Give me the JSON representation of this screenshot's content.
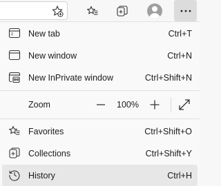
{
  "toolbar": {
    "favorite_add_icon": "star-plus-icon",
    "favorites_icon": "favorites-icon",
    "collections_icon": "collections-icon",
    "profile_icon": "avatar-icon",
    "more_icon": "ellipsis-icon"
  },
  "menu": {
    "new_tab": {
      "label": "New tab",
      "shortcut": "Ctrl+T",
      "icon": "new-tab-icon"
    },
    "new_window": {
      "label": "New window",
      "shortcut": "Ctrl+N",
      "icon": "window-icon"
    },
    "new_inprivate": {
      "label": "New InPrivate window",
      "shortcut": "Ctrl+Shift+N",
      "icon": "inprivate-icon"
    },
    "zoom": {
      "label": "Zoom",
      "value": "100%",
      "minus": "—",
      "plus": "+",
      "expand_icon": "fullscreen-icon"
    },
    "favorites": {
      "label": "Favorites",
      "shortcut": "Ctrl+Shift+O",
      "icon": "favorites-icon"
    },
    "collections": {
      "label": "Collections",
      "shortcut": "Ctrl+Shift+Y",
      "icon": "collections-icon"
    },
    "history": {
      "label": "History",
      "shortcut": "Ctrl+H",
      "icon": "history-icon"
    }
  },
  "colors": {
    "menu_bg": "#f9f9f9",
    "hover_bg": "#e7e7e7",
    "text": "#1b1b1b"
  }
}
